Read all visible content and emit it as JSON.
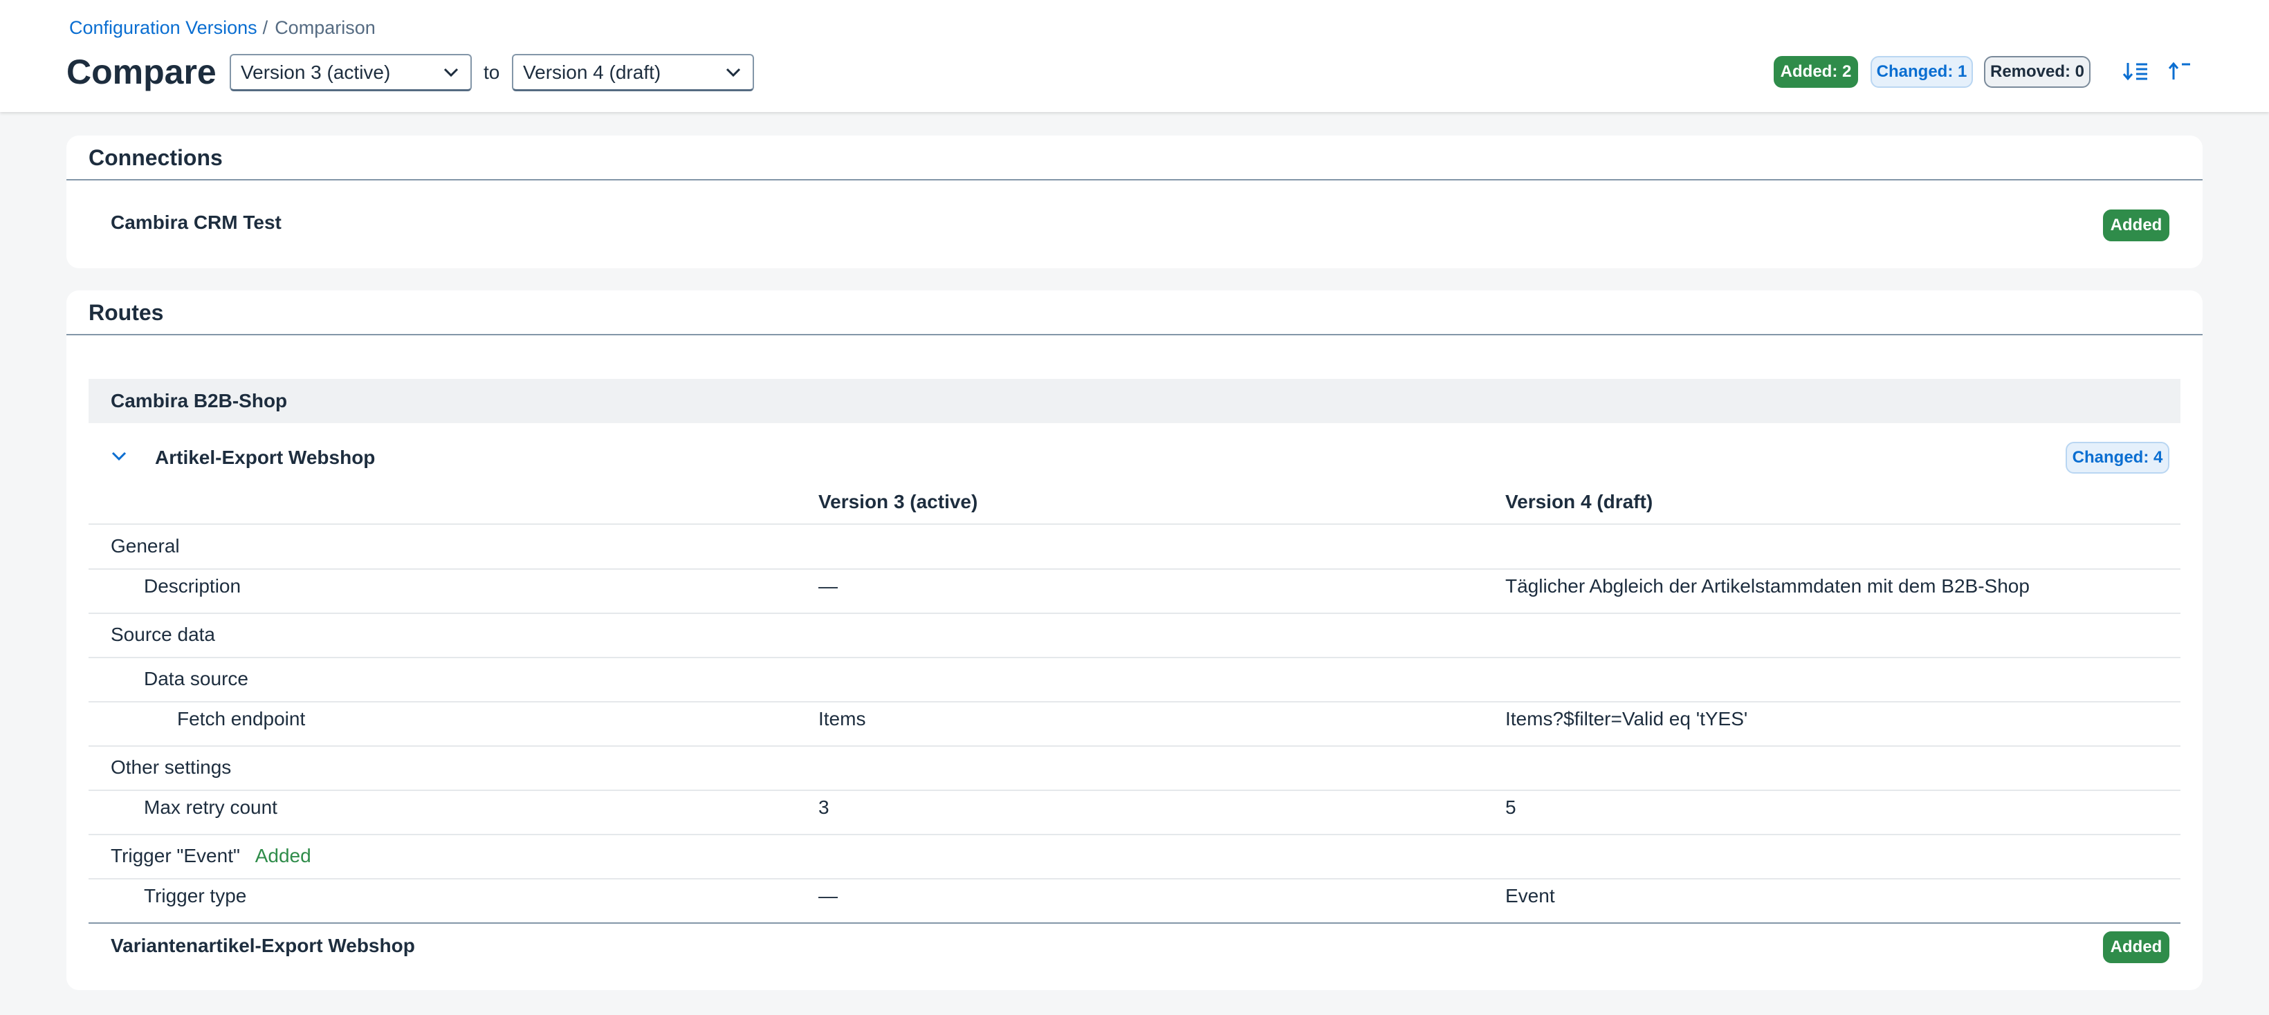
{
  "breadcrumb": {
    "link": "Configuration Versions",
    "separator": "/",
    "current": "Comparison"
  },
  "header": {
    "title": "Compare",
    "from_version": "Version 3 (active)",
    "to_label": "to",
    "to_version": "Version 4 (draft)",
    "summary": {
      "added": "Added: 2",
      "changed": "Changed: 1",
      "removed": "Removed: 0"
    },
    "icons": [
      "sort-descending-icon",
      "collapse-all-icon"
    ]
  },
  "connections": {
    "title": "Connections",
    "items": [
      {
        "name": "Cambira CRM Test",
        "status": "Added"
      }
    ]
  },
  "routes": {
    "title": "Routes",
    "group": "Cambira B2B-Shop",
    "route": {
      "name": "Artikel-Export Webshop",
      "status": "Changed: 4"
    },
    "columns": {
      "from": "Version 3 (active)",
      "to": "Version 4 (draft)"
    },
    "rows": [
      {
        "label": "General"
      },
      {
        "label": "Description",
        "from": "—",
        "to": "Täglicher Abgleich der Artikelstammdaten mit dem B2B-Shop"
      },
      {
        "label": "Source data"
      },
      {
        "label": "Data source"
      },
      {
        "label": "Fetch endpoint",
        "from": "Items",
        "to": "Items?$filter=Valid eq 'tYES'"
      },
      {
        "label": "Other settings"
      },
      {
        "label": "Max retry count",
        "from": "3",
        "to": "5"
      },
      {
        "label": "Trigger \"Event\"",
        "badge": "Added"
      },
      {
        "label": "Trigger type",
        "from": "—",
        "to": "Event"
      }
    ],
    "other_route": {
      "name": "Variantenartikel-Export Webshop",
      "status": "Added"
    }
  },
  "colors": {
    "added": "#2f8c4a",
    "changed": "#0a6ed1",
    "link": "#0a6ed1",
    "text": "#1d2d3e"
  }
}
